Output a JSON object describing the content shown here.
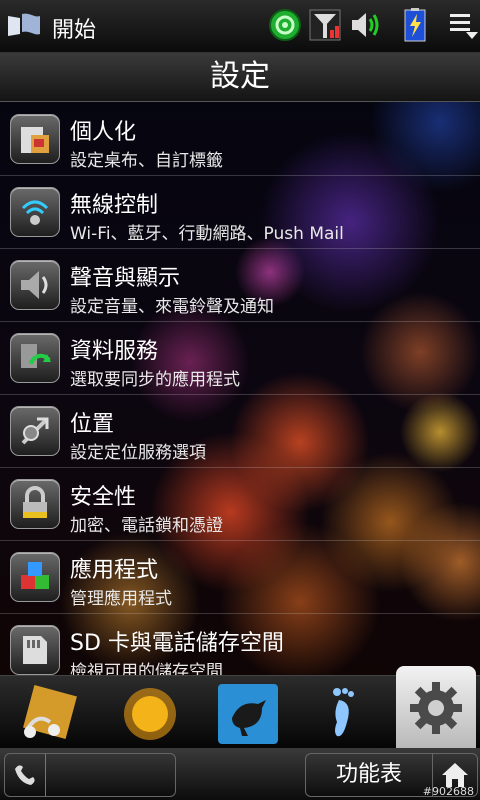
{
  "statusbar": {
    "start_label": "開始",
    "icons": [
      "sync-icon",
      "signal-icon",
      "volume-icon",
      "battery-icon",
      "menu-icon"
    ]
  },
  "title": "設定",
  "settings": [
    {
      "title": "個人化",
      "subtitle": "設定桌布、自訂標籤",
      "icon": "personalize-icon"
    },
    {
      "title": "無線控制",
      "subtitle": "Wi-Fi、藍牙、行動網路、Push Mail",
      "icon": "wireless-icon"
    },
    {
      "title": "聲音與顯示",
      "subtitle": "設定音量、來電鈴聲及通知",
      "icon": "speaker-icon"
    },
    {
      "title": "資料服務",
      "subtitle": "選取要同步的應用程式",
      "icon": "data-sync-icon"
    },
    {
      "title": "位置",
      "subtitle": "設定定位服務選項",
      "icon": "location-icon"
    },
    {
      "title": "安全性",
      "subtitle": "加密、電話鎖和憑證",
      "icon": "lock-icon"
    },
    {
      "title": "應用程式",
      "subtitle": "管理應用程式",
      "icon": "apps-icon"
    },
    {
      "title": "SD 卡與電話儲存空間",
      "subtitle": "檢視可用的儲存空間",
      "icon": "storage-icon"
    }
  ],
  "tabs": [
    {
      "name": "music-tab",
      "icon": "headphones-icon"
    },
    {
      "name": "weather-tab",
      "icon": "sun-icon"
    },
    {
      "name": "twitter-tab",
      "icon": "bird-icon"
    },
    {
      "name": "footprints-tab",
      "icon": "footprint-icon"
    },
    {
      "name": "settings-tab",
      "icon": "gear-icon",
      "selected": true
    }
  ],
  "bottombar": {
    "menu_label": "功能表"
  },
  "watermark": "#902688",
  "colors": {
    "statusbar": "#1a1a1a",
    "sync_green": "#1fae2f",
    "battery_blue": "#1d4fd8"
  }
}
